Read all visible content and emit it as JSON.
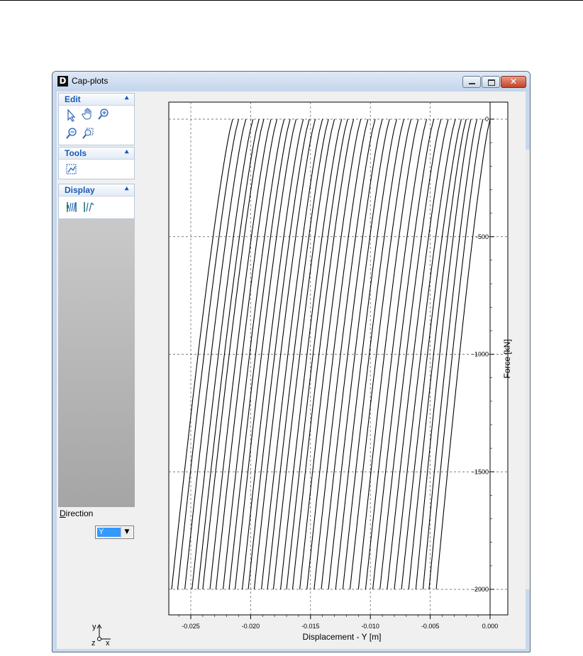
{
  "window": {
    "title": "Cap-plots",
    "app_icon_letter": "D",
    "close_glyph": "✕"
  },
  "sidebar": {
    "panels": [
      {
        "id": "edit",
        "title": "Edit",
        "icons": [
          "pointer-icon",
          "pan-hand-icon",
          "zoom-in-icon",
          "zoom-out-icon",
          "zoom-rect-icon"
        ]
      },
      {
        "id": "tools",
        "title": "Tools",
        "icons": [
          "export-plot-icon"
        ]
      },
      {
        "id": "display",
        "title": "Display",
        "icons": [
          "show-curves-icon",
          "scale-curves-icon"
        ]
      }
    ],
    "collapse_glyph": "⯅",
    "direction": {
      "label_prefix": "D",
      "label_rest": "irection",
      "value": "Y"
    },
    "axes": {
      "y": "y",
      "z": "z",
      "x": "x"
    }
  },
  "chart_data": {
    "type": "line",
    "title": "",
    "xlabel": "Displacement - Y [m]",
    "ylabel": "Force [kN]",
    "xlim": [
      -0.0285,
      0.0015
    ],
    "ylim": [
      -2100,
      50
    ],
    "xticks": [
      -0.025,
      -0.02,
      -0.015,
      -0.01,
      -0.005,
      0.0
    ],
    "xtick_labels": [
      "-0.025",
      "-0.020",
      "-0.015",
      "-0.010",
      "-0.005",
      "0.000"
    ],
    "yticks": [
      0,
      -500,
      -1000,
      -1500,
      -2000
    ],
    "ytick_labels": [
      "0",
      "-500",
      "-1000",
      "-1500",
      "-2000"
    ],
    "grid": true,
    "line_color": "#000000",
    "series_description": "Family of nearly parallel load-displacement curves from Force 0 down to Force -2000 kN",
    "curves": [
      {
        "x0": -0.0215,
        "x_end": -0.0266
      },
      {
        "x0": -0.021,
        "x_end": -0.0261
      },
      {
        "x0": -0.0204,
        "x_end": -0.0255
      },
      {
        "x0": -0.0198,
        "x_end": -0.0249
      },
      {
        "x0": -0.0193,
        "x_end": -0.0244
      },
      {
        "x0": -0.0189,
        "x_end": -0.024
      },
      {
        "x0": -0.0183,
        "x_end": -0.0234
      },
      {
        "x0": -0.0178,
        "x_end": -0.0229
      },
      {
        "x0": -0.0172,
        "x_end": -0.0223
      },
      {
        "x0": -0.0167,
        "x_end": -0.0218
      },
      {
        "x0": -0.0162,
        "x_end": -0.0213
      },
      {
        "x0": -0.0156,
        "x_end": -0.0207
      },
      {
        "x0": -0.0151,
        "x_end": -0.0202
      },
      {
        "x0": -0.0146,
        "x_end": -0.0197
      },
      {
        "x0": -0.014,
        "x_end": -0.0191
      },
      {
        "x0": -0.0135,
        "x_end": -0.0186
      },
      {
        "x0": -0.013,
        "x_end": -0.0181
      },
      {
        "x0": -0.0124,
        "x_end": -0.0175
      },
      {
        "x0": -0.0119,
        "x_end": -0.017
      },
      {
        "x0": -0.0114,
        "x_end": -0.0165
      },
      {
        "x0": -0.0108,
        "x_end": -0.0159
      },
      {
        "x0": -0.0102,
        "x_end": -0.0153
      },
      {
        "x0": -0.0096,
        "x_end": -0.0147
      },
      {
        "x0": -0.009,
        "x_end": -0.0141
      },
      {
        "x0": -0.0084,
        "x_end": -0.0135
      },
      {
        "x0": -0.0078,
        "x_end": -0.0129
      },
      {
        "x0": -0.0072,
        "x_end": -0.0123
      },
      {
        "x0": -0.0066,
        "x_end": -0.0117
      },
      {
        "x0": -0.006,
        "x_end": -0.011
      },
      {
        "x0": -0.0053,
        "x_end": -0.0104
      },
      {
        "x0": -0.0047,
        "x_end": -0.0098
      },
      {
        "x0": -0.0041,
        "x_end": -0.0092
      },
      {
        "x0": -0.0035,
        "x_end": -0.0086
      },
      {
        "x0": -0.0029,
        "x_end": -0.008
      },
      {
        "x0": -0.0024,
        "x_end": -0.0074
      },
      {
        "x0": -0.002,
        "x_end": -0.0068
      },
      {
        "x0": -0.0016,
        "x_end": -0.0062
      },
      {
        "x0": -0.0011,
        "x_end": -0.0056
      },
      {
        "x0": -0.0006,
        "x_end": -0.0051
      },
      {
        "x0": 0.0,
        "x_end": -0.0045
      }
    ]
  }
}
